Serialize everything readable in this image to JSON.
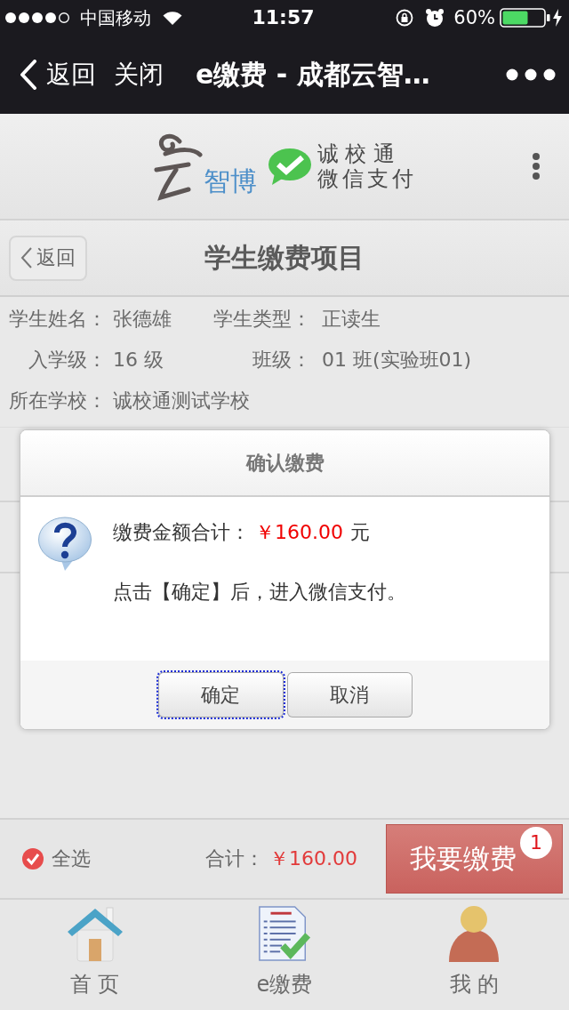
{
  "status_bar": {
    "carrier": "中国移动",
    "time": "11:57",
    "battery": "60%"
  },
  "nav_bar": {
    "back": "返回",
    "close": "关闭",
    "title": "e缴费 - 成都云智…"
  },
  "header": {
    "logo_text": "智博",
    "brand_lines": [
      "诚 校 通",
      "微信支付"
    ]
  },
  "page": {
    "back": "返回",
    "title": "学生缴费项目"
  },
  "student_info": [
    {
      "fields": [
        {
          "label": "学生姓名：",
          "value": "张德雄"
        },
        {
          "label": "学生类型：",
          "value": "正读生"
        }
      ]
    },
    {
      "fields": [
        {
          "label": "入学级：",
          "value": "16 级"
        },
        {
          "label": "班级：",
          "value": "01 班(实验班01)"
        }
      ]
    },
    {
      "fields": [
        {
          "label": "所在学校：",
          "value": "诚校通测试学校"
        }
      ]
    }
  ],
  "dialog": {
    "title": "确认缴费",
    "amount_label": "缴费金额合计：",
    "amount": "￥160.00",
    "amount_unit": "元",
    "note": "点击【确定】后，进入微信支付。",
    "buttons": [
      {
        "label": "确定",
        "focused": true
      },
      {
        "label": "取消",
        "focused": false
      }
    ]
  },
  "footer_bar": {
    "select_all": {
      "label": "全选",
      "checked": true
    },
    "total_label": "合计：",
    "total": "￥160.00",
    "pay_button": {
      "label": "我要缴费",
      "badge": "1"
    }
  },
  "tab_bar": [
    {
      "kind": "home",
      "label": "首 页"
    },
    {
      "kind": "bill",
      "label": "e缴费"
    },
    {
      "kind": "profile",
      "label": "我 的"
    }
  ]
}
